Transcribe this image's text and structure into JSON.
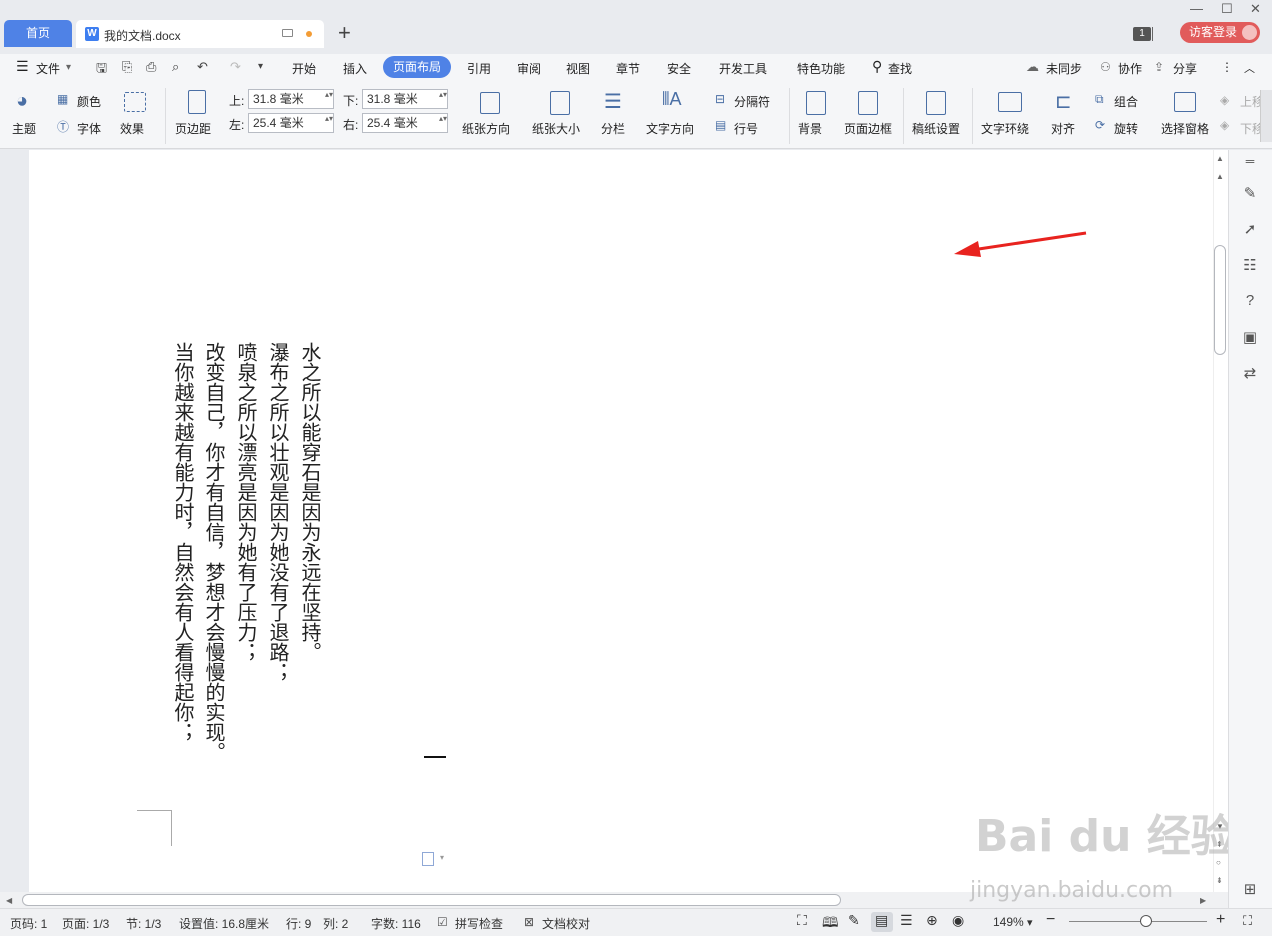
{
  "tabs": {
    "home": "首页",
    "doc_title": "我的文档.docx",
    "badge": "1",
    "login": "访客登录"
  },
  "menu": {
    "file": "文件",
    "items": [
      "开始",
      "插入",
      "页面布局",
      "引用",
      "审阅",
      "视图",
      "章节",
      "安全",
      "开发工具",
      "特色功能"
    ],
    "active": "页面布局",
    "search": "查找",
    "sync": "未同步",
    "collab": "协作",
    "share": "分享"
  },
  "ribbon": {
    "theme": "主题",
    "color": "颜色",
    "font": "字体",
    "effect": "效果",
    "margin": "页边距",
    "top_label": "上:",
    "top_value": "31.8 毫米",
    "bottom_label": "下:",
    "bottom_value": "31.8 毫米",
    "left_label": "左:",
    "left_value": "25.4 毫米",
    "right_label": "右:",
    "right_value": "25.4 毫米",
    "orientation": "纸张方向",
    "size": "纸张大小",
    "columns": "分栏",
    "text_direction": "文字方向",
    "separator": "分隔符",
    "line_number": "行号",
    "background": "背景",
    "page_border": "页面边框",
    "manuscript": "稿纸设置",
    "wrap": "文字环绕",
    "align": "对齐",
    "group": "组合",
    "rotate": "旋转",
    "selection_pane": "选择窗格",
    "up_layer": "上移",
    "down_layer": "下移"
  },
  "document": {
    "lines": [
      "当你越来越有能力时，自然会有人看得起你；",
      "改变自己，你才有自信，梦想才会慢慢的实现。",
      "喷泉之所以漂亮是因为她有了压力；",
      "瀑布之所以壮观是因为她没有了退路；",
      "水之所以能穿石是因为永远在坚持。"
    ]
  },
  "status": {
    "page_num": "页码: 1",
    "page": "页面: 1/3",
    "section": "节: 1/3",
    "setting": "设置值: 16.8厘米",
    "row": "行: 9",
    "col": "列: 2",
    "words": "字数: 116",
    "spell": "拼写检查",
    "proof": "文档校对",
    "zoom": "149%"
  },
  "watermark": {
    "logo": "Bai du 经验",
    "url": "jingyan.baidu.com"
  },
  "colors": {
    "accent": "#4f82e6",
    "login": "#e15b5b",
    "arrow": "#e8231f"
  }
}
